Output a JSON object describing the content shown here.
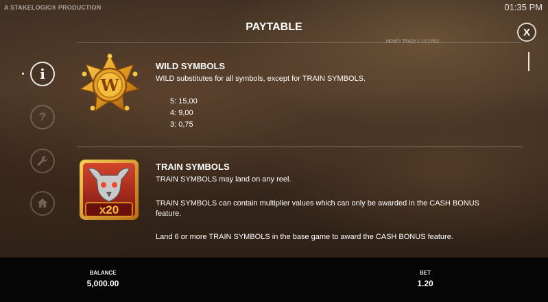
{
  "header": {
    "provider": "A STAKELOGIC® PRODUCTION",
    "clock": "01:35 PM",
    "title": "PAYTABLE",
    "close_label": "X",
    "version": "MONEY TRACK 2 1.0.2.RC2"
  },
  "side_nav": {
    "items": [
      {
        "name": "info",
        "label": "i",
        "active": true
      },
      {
        "name": "help",
        "label": "?",
        "active": false
      },
      {
        "name": "settings",
        "icon": "wrench-icon",
        "active": false
      },
      {
        "name": "home",
        "icon": "home-icon",
        "active": false
      }
    ]
  },
  "wild": {
    "title": "WILD SYMBOLS",
    "description": "WILD substitutes for all symbols, except for TRAIN SYMBOLS.",
    "icon_letter": "W",
    "payouts": [
      "5: 15,00",
      "4: 9,00",
      "3: 0,75"
    ]
  },
  "train": {
    "title": "TRAIN SYMBOLS",
    "badge": "x20",
    "paragraphs": [
      "TRAIN SYMBOLS may land on any reel.",
      "TRAIN SYMBOLS can contain multiplier values which can only be awarded in the CASH BONUS",
      "feature.",
      "Land 6 or more TRAIN SYMBOLS in the base game to award the CASH BONUS feature."
    ]
  },
  "footer": {
    "balance_label": "BALANCE",
    "balance_value": "5,000.00",
    "bet_label": "BET",
    "bet_value": "1.20"
  },
  "colors": {
    "gold": "#e8a92a",
    "dark_gold": "#8a5210",
    "train_red": "#a8231a",
    "bottom_bar": "#050505"
  }
}
